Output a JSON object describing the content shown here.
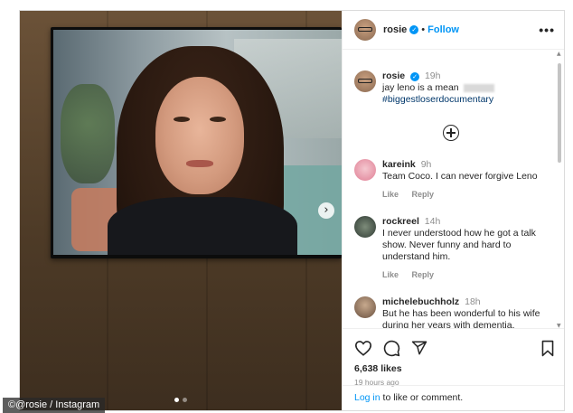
{
  "post": {
    "username": "rosie",
    "bullet": "•",
    "follow_label": "Follow",
    "more_icon": "more-icon",
    "carousel_next_icon": "chevron-right-icon",
    "active_slide": 1,
    "slide_count": 2
  },
  "caption": {
    "username": "rosie",
    "time": "19h",
    "text": "jay leno is a mean",
    "hashtag": "#biggestloserdocumentary"
  },
  "comments": [
    {
      "username": "kareink",
      "time": "9h",
      "text": "Team Coco. I can never forgive Leno",
      "like_label": "Like",
      "reply_label": "Reply"
    },
    {
      "username": "rockreel",
      "time": "14h",
      "text": "I never understood how he got a talk show. Never funny and hard to understand him.",
      "like_label": "Like",
      "reply_label": "Reply"
    },
    {
      "username": "michelebuchholz",
      "time": "18h",
      "text": "But he has been wonderful to his wife during her years with dementia."
    }
  ],
  "footer": {
    "likes": "6,638 likes",
    "time_ago": "19 hours ago",
    "login_link": "Log in",
    "login_suffix": " to like or comment."
  },
  "watermark": "©@rosie / Instagram",
  "colors": {
    "accent": "#0095f6",
    "hashtag": "#00376b",
    "muted": "#8e8e8e"
  }
}
